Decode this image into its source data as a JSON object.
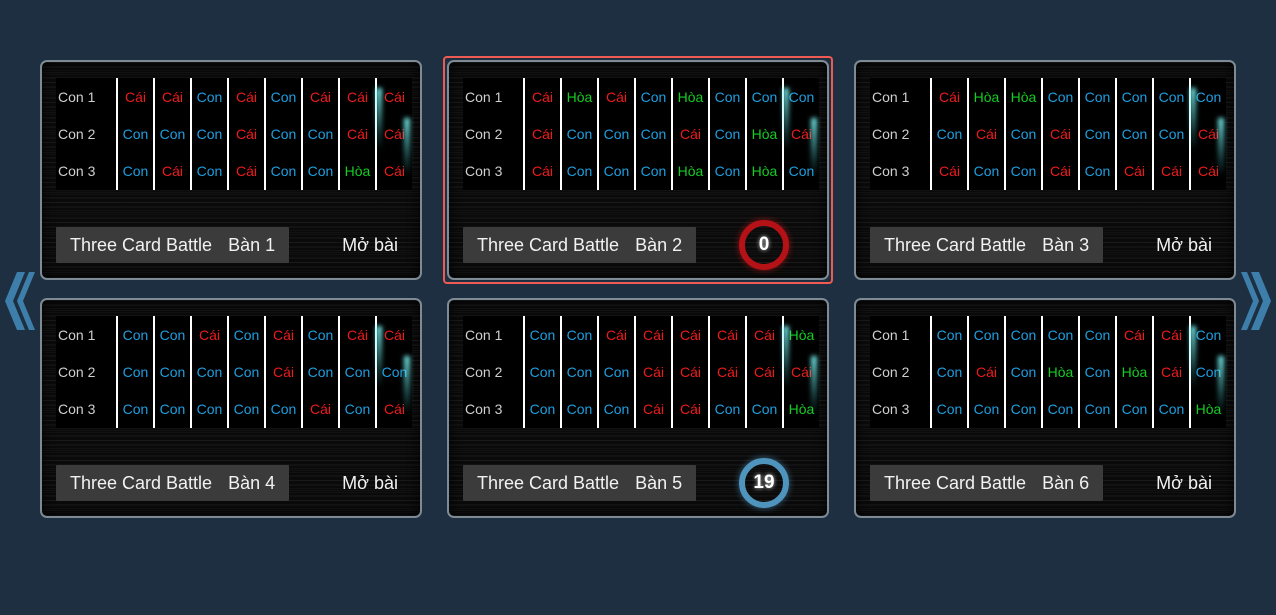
{
  "background_color": "#1d2f40",
  "colors": {
    "cai": "#ee1b1b",
    "con": "#1e9fe0",
    "hoa": "#15cc23",
    "selected_border": "#ef5a52",
    "timer_red": "#b51217",
    "timer_blue": "#4f94bd",
    "nav_arrow": "#3d7faa"
  },
  "nav": {
    "prev_icon": "double-chevron-left-icon",
    "next_icon": "double-chevron-right-icon"
  },
  "row_labels": [
    "Con 1",
    "Con 2",
    "Con 3"
  ],
  "tables": [
    {
      "game_title": "Three Card Battle",
      "table_name": "Bàn 1",
      "status_label": "Mở bài",
      "timer": null,
      "timer_color": null,
      "selected": false,
      "columns": [
        [
          "Cái",
          "Con",
          "Con"
        ],
        [
          "Cái",
          "Con",
          "Cái"
        ],
        [
          "Con",
          "Con",
          "Con"
        ],
        [
          "Cái",
          "Cái",
          "Cái"
        ],
        [
          "Con",
          "Con",
          "Con"
        ],
        [
          "Cái",
          "Con",
          "Con"
        ],
        [
          "Cái",
          "Cái",
          "Hòa"
        ],
        [
          "Cái",
          "Cái",
          "Cái"
        ]
      ]
    },
    {
      "game_title": "Three Card Battle",
      "table_name": "Bàn 2",
      "status_label": null,
      "timer": "0",
      "timer_color": "red",
      "selected": true,
      "columns": [
        [
          "Cái",
          "Cái",
          "Cái"
        ],
        [
          "Hòa",
          "Con",
          "Con"
        ],
        [
          "Cái",
          "Con",
          "Con"
        ],
        [
          "Con",
          "Con",
          "Con"
        ],
        [
          "Hòa",
          "Cái",
          "Hòa"
        ],
        [
          "Con",
          "Con",
          "Con"
        ],
        [
          "Con",
          "Hòa",
          "Hòa"
        ],
        [
          "Con",
          "Cái",
          "Con"
        ]
      ]
    },
    {
      "game_title": "Three Card Battle",
      "table_name": "Bàn 3",
      "status_label": "Mở bài",
      "timer": null,
      "timer_color": null,
      "selected": false,
      "columns": [
        [
          "Cái",
          "Con",
          "Cái"
        ],
        [
          "Hòa",
          "Cái",
          "Con"
        ],
        [
          "Hòa",
          "Con",
          "Con"
        ],
        [
          "Con",
          "Cái",
          "Cái"
        ],
        [
          "Con",
          "Con",
          "Con"
        ],
        [
          "Con",
          "Con",
          "Cái"
        ],
        [
          "Con",
          "Con",
          "Cái"
        ],
        [
          "Con",
          "Cái",
          "Cái"
        ]
      ]
    },
    {
      "game_title": "Three Card Battle",
      "table_name": "Bàn 4",
      "status_label": "Mở bài",
      "timer": null,
      "timer_color": null,
      "selected": false,
      "columns": [
        [
          "Con",
          "Con",
          "Con"
        ],
        [
          "Con",
          "Con",
          "Con"
        ],
        [
          "Cái",
          "Con",
          "Con"
        ],
        [
          "Con",
          "Con",
          "Con"
        ],
        [
          "Cái",
          "Cái",
          "Con"
        ],
        [
          "Con",
          "Con",
          "Cái"
        ],
        [
          "Cái",
          "Con",
          "Con"
        ],
        [
          "Cái",
          "Con",
          "Cái"
        ]
      ]
    },
    {
      "game_title": "Three Card Battle",
      "table_name": "Bàn 5",
      "status_label": null,
      "timer": "19",
      "timer_color": "blue",
      "selected": false,
      "columns": [
        [
          "Con",
          "Con",
          "Con"
        ],
        [
          "Con",
          "Con",
          "Con"
        ],
        [
          "Cái",
          "Con",
          "Con"
        ],
        [
          "Cái",
          "Cái",
          "Cái"
        ],
        [
          "Cái",
          "Cái",
          "Cái"
        ],
        [
          "Cái",
          "Cái",
          "Con"
        ],
        [
          "Cái",
          "Cái",
          "Con"
        ],
        [
          "Hòa",
          "Cái",
          "Hòa"
        ]
      ]
    },
    {
      "game_title": "Three Card Battle",
      "table_name": "Bàn 6",
      "status_label": "Mở bài",
      "timer": null,
      "timer_color": null,
      "selected": false,
      "columns": [
        [
          "Con",
          "Con",
          "Con"
        ],
        [
          "Con",
          "Cái",
          "Con"
        ],
        [
          "Con",
          "Con",
          "Con"
        ],
        [
          "Con",
          "Hòa",
          "Con"
        ],
        [
          "Con",
          "Con",
          "Con"
        ],
        [
          "Cái",
          "Hòa",
          "Con"
        ],
        [
          "Cái",
          "Cái",
          "Con"
        ],
        [
          "Con",
          "Con",
          "Hòa"
        ]
      ]
    }
  ]
}
